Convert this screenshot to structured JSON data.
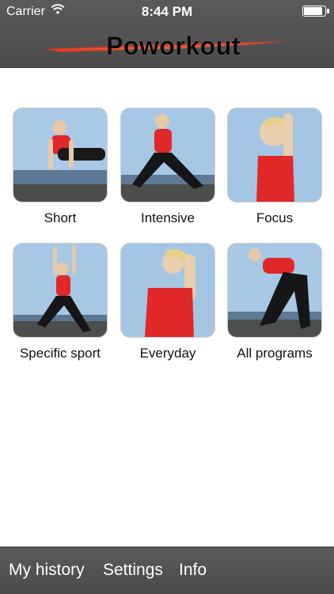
{
  "status_bar": {
    "carrier": "Carrier",
    "time": "8:44 PM",
    "battery_level": 0.95
  },
  "header": {
    "logo_text": "Poworkout",
    "colors": {
      "bar": "#4f4f4f",
      "swoosh": "#e23a1f"
    }
  },
  "programs": [
    {
      "label": "Short",
      "photo": "woman-plank-by-sea"
    },
    {
      "label": "Intensive",
      "photo": "woman-lunge-stretch"
    },
    {
      "label": "Focus",
      "photo": "woman-arm-stretch-close"
    },
    {
      "label": "Specific sport",
      "photo": "woman-lunge-arms-up"
    },
    {
      "label": "Everyday",
      "photo": "woman-shoulder-stretch-close"
    },
    {
      "label": "All programs",
      "photo": "woman-bend-stretch"
    }
  ],
  "tab_bar": {
    "items": [
      "My history",
      "Settings",
      "Info"
    ]
  }
}
